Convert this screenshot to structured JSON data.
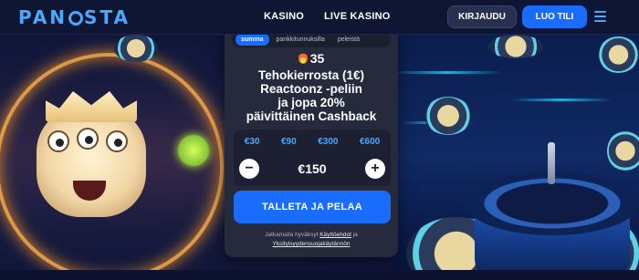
{
  "brand": {
    "logo_text_left": "PAN",
    "logo_text_right": "STA"
  },
  "nav": {
    "items": [
      "KASINO",
      "LIVE KASINO"
    ]
  },
  "header": {
    "login_label": "KIRJAUDU",
    "register_label": "LUO TILI"
  },
  "deposit": {
    "tabs": [
      {
        "label": "summa",
        "active": true
      },
      {
        "label": "pankkitunnuksilla",
        "active": false
      },
      {
        "label": "peleistä",
        "active": false
      }
    ],
    "spins_count": "35",
    "promo_line1": "Tehokierrosta (1€)",
    "promo_line2": "Reactoonz -peliin",
    "promo_line3": "ja jopa 20%",
    "promo_line4": "päivittäinen Cashback",
    "quick_amounts": [
      "€30",
      "€90",
      "€300",
      "€600"
    ],
    "amount": "€150",
    "minus": "−",
    "plus": "+",
    "cta_label": "TALLETA JA PELAA",
    "terms_prefix": "Jatkamalla hyväksyt",
    "terms_link": "Käyttöehdot",
    "terms_and": "ja",
    "privacy_link": "Yksityisyydensuojakäytännön"
  },
  "colors": {
    "accent": "#1a6cff",
    "logo": "#4aa8ff",
    "panel": "#262a3d"
  }
}
